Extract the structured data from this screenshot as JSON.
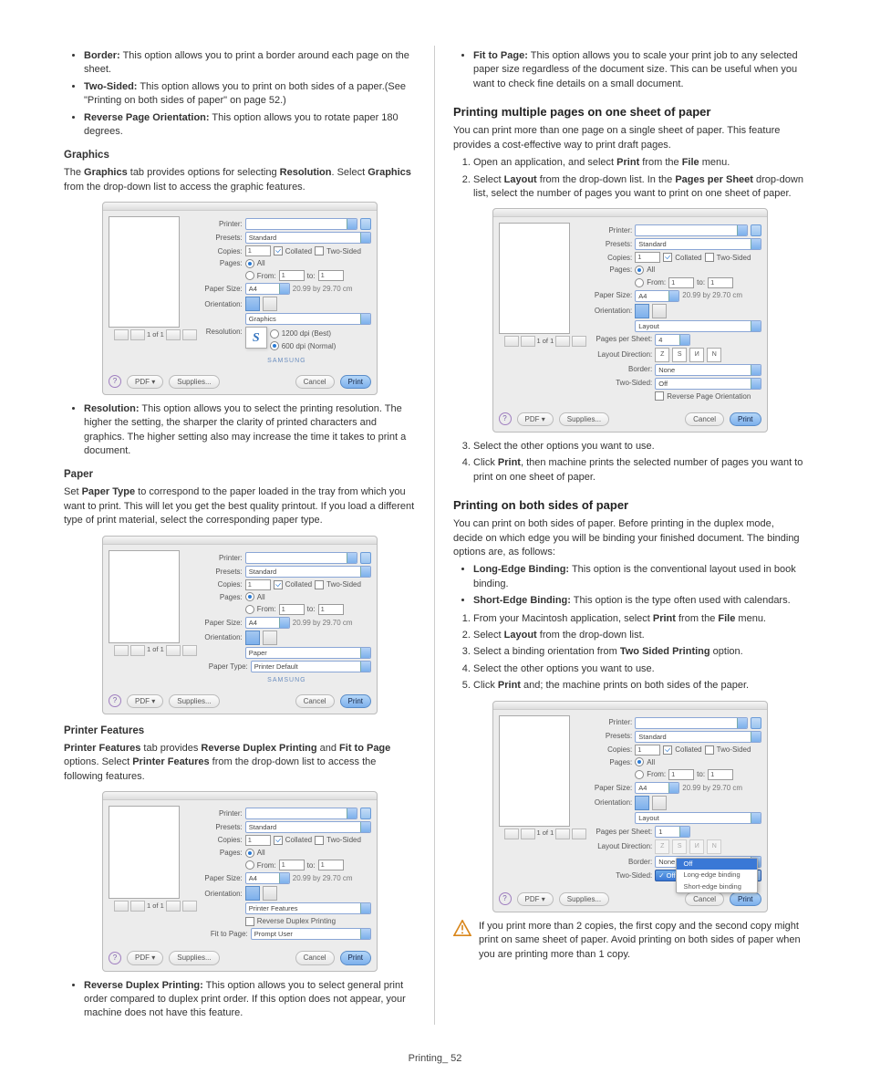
{
  "footer_page": "Printing_ 52",
  "left": {
    "bullets_top": [
      {
        "term": "Border:",
        "desc": " This option allows you to print a border around each page on the sheet."
      },
      {
        "term": "Two-Sided:",
        "desc": " This option allows you to print on both sides of a paper.(See \"Printing on both sides of paper\" on page 52.)"
      },
      {
        "term": "Reverse Page Orientation:",
        "desc": " This option allows you to rotate paper 180 degrees."
      }
    ],
    "graphics": {
      "heading": "Graphics",
      "intro_a": "The ",
      "intro_b": "Graphics",
      "intro_c": " tab provides options for selecting ",
      "intro_d": "Resolution",
      "intro_e": ". Select ",
      "intro_f": "Graphics",
      "intro_g": " from the drop-down list to access the graphic features.",
      "bullets": [
        {
          "term": "Resolution:",
          "desc": " This option allows you to select the printing resolution. The higher the setting, the sharper the clarity of printed characters and graphics. The higher setting also may increase the time it takes to print a document."
        }
      ]
    },
    "paper": {
      "heading": "Paper",
      "intro_a": "Set ",
      "intro_b": "Paper Type",
      "intro_c": " to correspond to the paper loaded in the tray from which you want to print. This will let you get the best quality printout. If you load a different type of print material, select the corresponding paper type."
    },
    "features": {
      "heading": "Printer Features",
      "intro_a": "Printer Features",
      "intro_b": " tab provides ",
      "intro_c": "Reverse Duplex Printing",
      "intro_d": " and ",
      "intro_e": "Fit to Page",
      "intro_f": " options. Select ",
      "intro_g": "Printer Features",
      "intro_h": " from the drop-down list to access the following features.",
      "bullets": [
        {
          "term": "Reverse Duplex Printing:",
          "desc": " This option allows you to select general print order compared to duplex print order. If this option does not appear, your machine does not have this feature."
        }
      ]
    }
  },
  "right": {
    "bullets_top": [
      {
        "term": "Fit to Page:",
        "desc": " This option allows you to scale your print job to any selected paper size regardless of the document size. This can be useful when you want to check fine details on a small document."
      }
    ],
    "multi": {
      "heading": "Printing multiple pages on one sheet of paper",
      "intro": "You can print more than one page on a single sheet of paper. This feature provides a cost-effective way to print draft pages.",
      "step1_a": "Open an application, and select ",
      "step1_b": "Print",
      "step1_c": " from the ",
      "step1_d": "File",
      "step1_e": " menu.",
      "step2_a": "Select ",
      "step2_b": "Layout",
      "step2_c": " from the drop-down list. In the ",
      "step2_d": "Pages per Sheet",
      "step2_e": " drop-down list, select the number of pages you want to print on one sheet of paper.",
      "step3": "Select the other options you want to use.",
      "step4_a": "Click ",
      "step4_b": "Print",
      "step4_c": ", then machine prints the selected number of pages you want to print on one sheet of paper."
    },
    "both": {
      "heading": "Printing on both sides of paper",
      "intro": "You can print on both sides of paper. Before printing in the duplex mode, decide on which edge you will be binding your finished document. The binding options are, as follows:",
      "bullet1_a": "Long-Edge Binding:",
      "bullet1_b": " This option is the conventional layout used in book binding.",
      "bullet2_a": "Short-Edge Binding:",
      "bullet2_b": " This option is the type often used with calendars.",
      "step1_a": "From your Macintosh application, select ",
      "step1_b": "Print",
      "step1_c": " from the ",
      "step1_d": "File",
      "step1_e": " menu.",
      "step2_a": "Select ",
      "step2_b": "Layout",
      "step2_c": " from the drop-down list.",
      "step3_a": "Select a binding orientation from ",
      "step3_b": "Two Sided Printing",
      "step3_c": " option.",
      "step4": "Select the other options you want to use.",
      "step5_a": "Click ",
      "step5_b": "Print",
      "step5_c": " and; the machine prints on both sides of the paper.",
      "note": "If you print more than 2 copies, the first copy and the second copy might print on same sheet of paper. Avoid printing on both sides of paper when you are printing more than 1 copy."
    }
  },
  "dlg": {
    "printer": "Printer:",
    "presets": "Presets:",
    "standard": "Standard",
    "copies": "Copies:",
    "one": "1",
    "collated": "Collated",
    "twosided": "Two-Sided",
    "pages": "Pages:",
    "all": "All",
    "from": "From:",
    "to": "to:",
    "paper_size": "Paper Size:",
    "a4": "A4",
    "dims": "20.99 by 29.70 cm",
    "orientation": "Orientation:",
    "graphics_tab": "Graphics",
    "resolution": "Resolution:",
    "res1": "1200 dpi (Best)",
    "res2": "600 dpi (Normal)",
    "paper_tab": "Paper",
    "paper_type": "Paper Type:",
    "printer_default": "Printer Default",
    "pf_tab": "Printer Features",
    "rdp": "Reverse Duplex Printing",
    "fit_to_page": "Fit to Page:",
    "prompt_user": "Prompt User",
    "layout_tab": "Layout",
    "pps": "Pages per Sheet:",
    "ld": "Layout Direction:",
    "border": "Border:",
    "none": "None",
    "twosided_lbl": "Two-Sided:",
    "off": "Off",
    "rpo": "Reverse Page Orientation",
    "menu_off": "Off",
    "menu_long": "Long-edge binding",
    "menu_short": "Short-edge binding",
    "pdf": "PDF ▾",
    "supplies": "Supplies...",
    "cancel": "Cancel",
    "print": "Print",
    "of": "1 of 1",
    "brand": "SAMSUNG",
    "s": "S",
    "four": "4"
  }
}
